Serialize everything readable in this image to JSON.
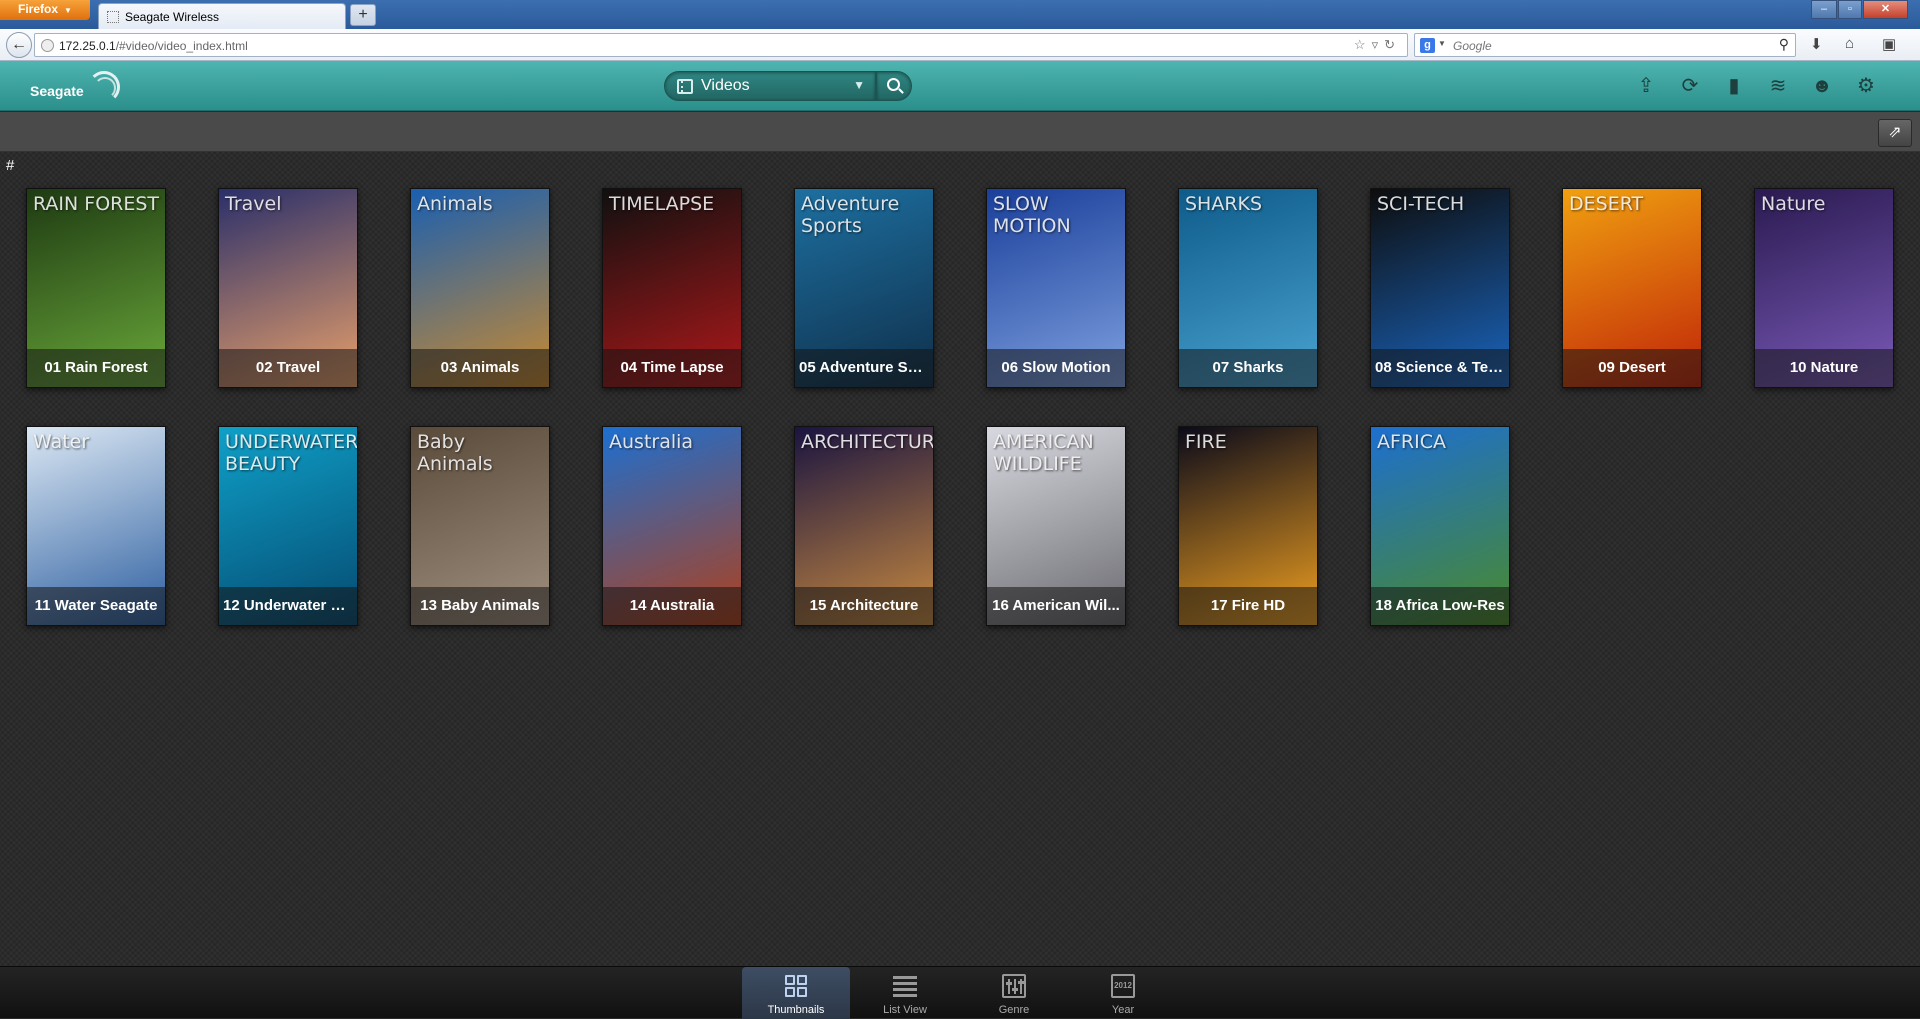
{
  "browser": {
    "menu_label": "Firefox",
    "tab_title": "Seagate Wireless",
    "new_tab": "+",
    "url_host": "172.25.0.1",
    "url_path": "/#video/video_index.html",
    "search_placeholder": "Google",
    "window_controls": {
      "minimize": "–",
      "maximize": "▫",
      "close": "✕"
    }
  },
  "app": {
    "brand": "Seagate",
    "selector_label": "Videos",
    "header_icons": [
      "upload-icon",
      "sync-icon",
      "battery-icon",
      "wifi-icon",
      "users-icon",
      "settings-icon"
    ]
  },
  "content": {
    "section_letter": "#",
    "videos": [
      {
        "title": "01 Rain Forest",
        "tag": "RAIN FOREST",
        "colors": [
          "#1e3a12",
          "#6aa83a"
        ]
      },
      {
        "title": "02 Travel",
        "tag": "Travel",
        "colors": [
          "#2a2f6a",
          "#e8a06a"
        ]
      },
      {
        "title": "03 Animals",
        "tag": "Animals",
        "colors": [
          "#1a5fb0",
          "#c98a30"
        ]
      },
      {
        "title": "04 Time Lapse",
        "tag": "TIMELAPSE",
        "colors": [
          "#101010",
          "#b0181a"
        ]
      },
      {
        "title": "05 Adventure Sp...",
        "tag": "Adventure Sports",
        "colors": [
          "#1d6fa0",
          "#0f2f4a"
        ]
      },
      {
        "title": "06 Slow Motion",
        "tag": "SLOW MOTION",
        "colors": [
          "#1a3f9a",
          "#7fa0e0"
        ]
      },
      {
        "title": "07 Sharks",
        "tag": "SHARKS",
        "colors": [
          "#0e5b8a",
          "#4aa3d0"
        ]
      },
      {
        "title": "08 Science & Tec...",
        "tag": "SCI-TECH",
        "colors": [
          "#0d0d0d",
          "#1a66c0"
        ]
      },
      {
        "title": "09 Desert",
        "tag": "DESERT",
        "colors": [
          "#f0a010",
          "#c02408"
        ]
      },
      {
        "title": "10 Nature",
        "tag": "Nature",
        "colors": [
          "#2a1a50",
          "#7a5ab8"
        ]
      },
      {
        "title": "11 Water Seagate",
        "tag": "Water",
        "colors": [
          "#dbe7f3",
          "#2d5fa0"
        ]
      },
      {
        "title": "12 Underwater B...",
        "tag": "UNDERWATER BEAUTY",
        "colors": [
          "#0fa0c8",
          "#054a70"
        ]
      },
      {
        "title": "13 Baby Animals",
        "tag": "Baby Animals",
        "colors": [
          "#5a4a3a",
          "#a09080"
        ]
      },
      {
        "title": "14 Australia",
        "tag": "Australia",
        "colors": [
          "#1d6fd0",
          "#b0401a"
        ]
      },
      {
        "title": "15 Architecture",
        "tag": "ARCHITECTURE",
        "colors": [
          "#1a1440",
          "#c88a40"
        ]
      },
      {
        "title": "16 American Wil...",
        "tag": "AMERICAN WILDLIFE",
        "colors": [
          "#d8d8e0",
          "#6a6a70"
        ]
      },
      {
        "title": "17 Fire HD",
        "tag": "FIRE",
        "colors": [
          "#0a0a1a",
          "#f0a020"
        ]
      },
      {
        "title": "18 Africa Low-Res",
        "tag": "AFRICA",
        "colors": [
          "#1d6fd0",
          "#4a8a2a"
        ]
      }
    ]
  },
  "bottom_tabs": [
    {
      "label": "Thumbnails",
      "active": true
    },
    {
      "label": "List View",
      "active": false
    },
    {
      "label": "Genre",
      "active": false
    },
    {
      "label": "Year",
      "active": false,
      "icon_text": "2012"
    }
  ]
}
